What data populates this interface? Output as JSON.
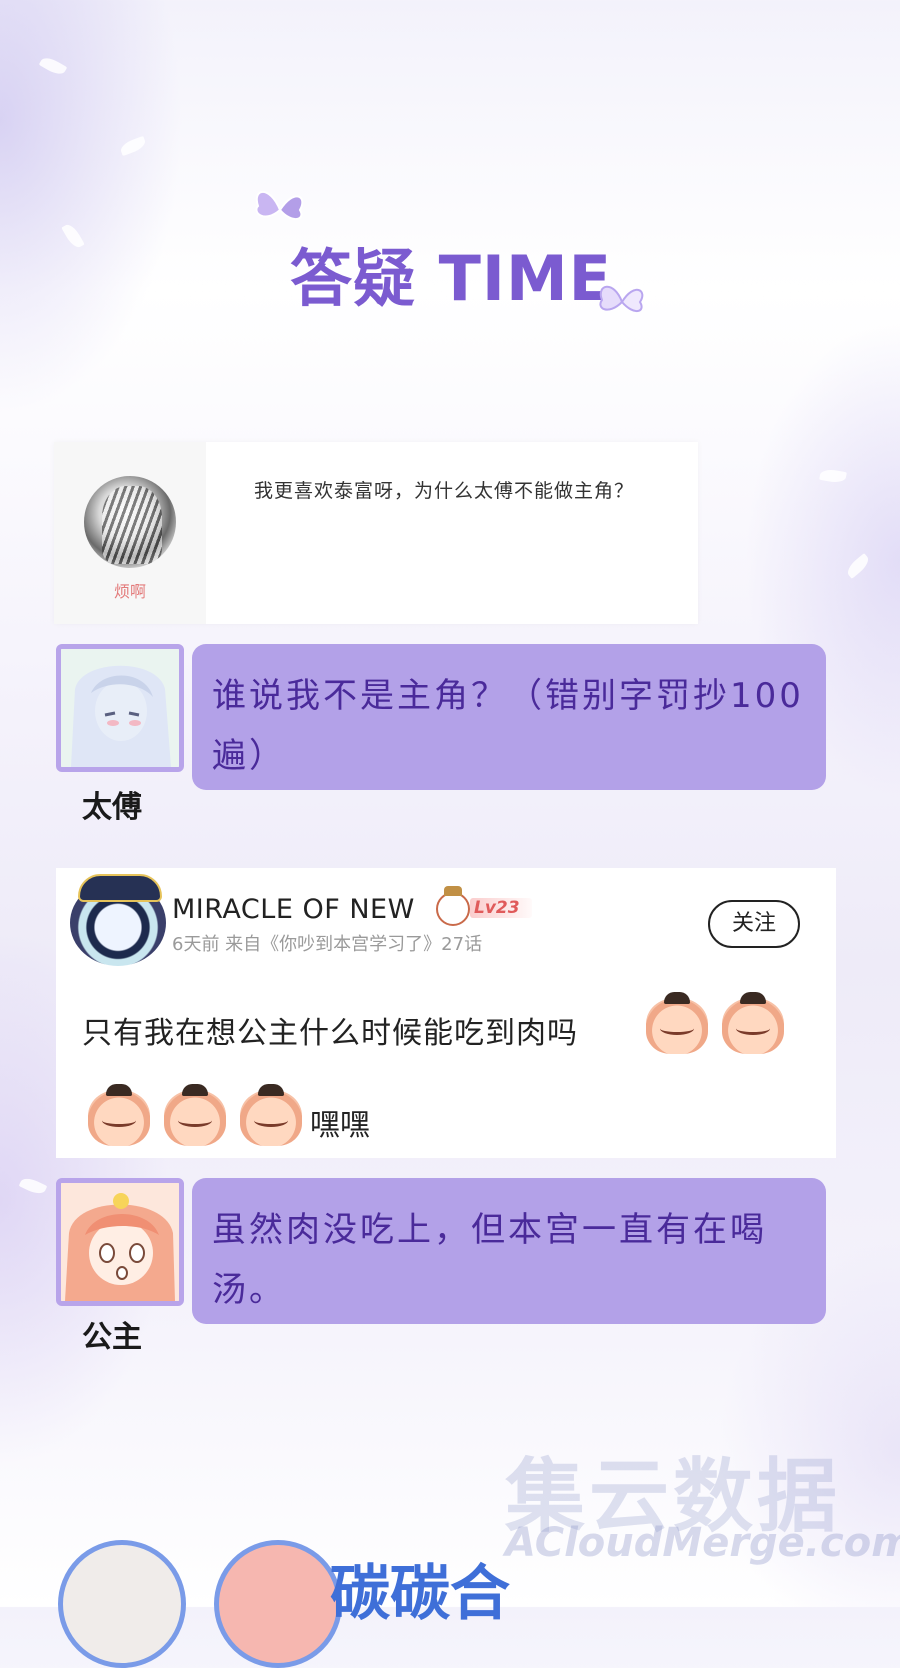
{
  "title": "答疑 TIME",
  "question": {
    "user_name": "烦啊",
    "text": "我更喜欢泰富呀，为什么太傅不能做主角？"
  },
  "answers": [
    {
      "speaker": "太傅",
      "text": "谁说我不是主角？（错别字罚抄100 遍）"
    },
    {
      "speaker": "公主",
      "text": "虽然肉没吃上，但本宫一直有在喝汤。"
    }
  ],
  "comment": {
    "user_name": "MIRACLE OF NEW",
    "level": "Lv23",
    "meta": "6天前  来自《你吵到本宫学习了》27话",
    "follow_label": "关注",
    "text": "只有我在想公主什么时候能吃到肉吗",
    "text2": "嘿嘿"
  },
  "watermark": {
    "cn": "集云数据",
    "en": "ACloudMerge.com"
  },
  "footer_title_partial": "碳碳合",
  "colors": {
    "title": "#7b5bd0",
    "bubble": "#b3a1e8",
    "bubble_text": "#4a2a9a",
    "level": "#e05a5a"
  },
  "icons": [
    "butterfly-icon",
    "crown-icon",
    "emoji-icon"
  ]
}
